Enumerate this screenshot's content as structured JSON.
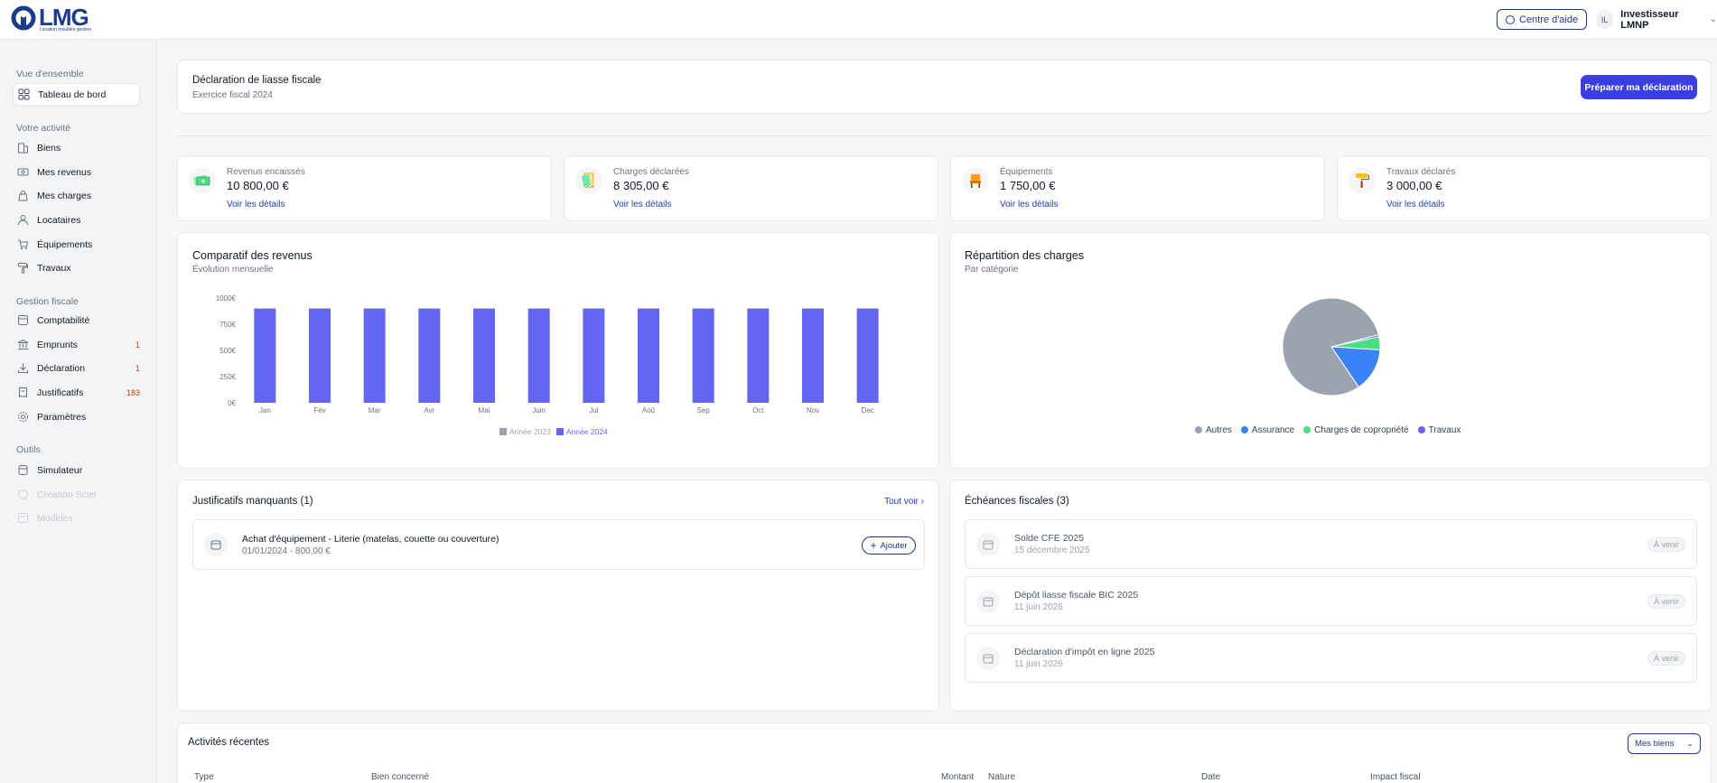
{
  "app": {
    "logo_text": "LMG",
    "logo_subtitle": "Location meublée gestion",
    "help_button": "Centre d'aide",
    "user_initials": "IL",
    "user_name": "Investisseur LMNP"
  },
  "sidebar": {
    "sections": [
      "Vue d'ensemble",
      "Votre activité",
      "Gestion fiscale",
      "Outils"
    ],
    "items": [
      {
        "label": "Tableau de bord",
        "icon": "dashboard-icon",
        "active": true
      },
      {
        "label": "Biens",
        "icon": "building-icon"
      },
      {
        "label": "Mes revenus",
        "icon": "money-icon"
      },
      {
        "label": "Mes charges",
        "icon": "bag-icon"
      },
      {
        "label": "Locataires",
        "icon": "user-icon"
      },
      {
        "label": "Équipements",
        "icon": "cart-icon"
      },
      {
        "label": "Travaux",
        "icon": "paint-roller-icon"
      },
      {
        "label": "Comptabilité",
        "icon": "ledger-icon"
      },
      {
        "label": "Emprunts",
        "icon": "bank-icon",
        "badge": "1"
      },
      {
        "label": "Déclaration",
        "icon": "download-icon",
        "badge": "1"
      },
      {
        "label": "Justificatifs",
        "icon": "receipt-icon",
        "badge": "183"
      },
      {
        "label": "Paramètres",
        "icon": "gear-icon"
      },
      {
        "label": "Simulateur",
        "icon": "calculator-icon"
      },
      {
        "label": "Création Sciel",
        "icon": "shield-icon",
        "disabled": true
      },
      {
        "label": "Modèles",
        "icon": "template-icon",
        "disabled": true
      }
    ]
  },
  "declaration": {
    "title": "Déclaration de liasse fiscale",
    "subtitle": "Exercice fiscal 2024",
    "button": "Préparer ma déclaration"
  },
  "stats": [
    {
      "label": "Revenus encaissés",
      "value": "10 800,00 €",
      "link": "Voir les détails",
      "icon": "cash-icon"
    },
    {
      "label": "Charges déclarées",
      "value": "8 305,00 €",
      "link": "Voir les détails",
      "icon": "invoice-icon"
    },
    {
      "label": "Équipements",
      "value": "1 750,00 €",
      "link": "Voir les détails",
      "icon": "chair-icon"
    },
    {
      "label": "Travaux déclarés",
      "value": "3 000,00 €",
      "link": "Voir les détails",
      "icon": "paint-roller-icon"
    }
  ],
  "revenue_chart": {
    "title": "Comparatif des revenus",
    "subtitle": "Évolution mensuelle",
    "legend": [
      "Année 2023",
      "Année 2024"
    ]
  },
  "charges_chart": {
    "title": "Répartition des charges",
    "subtitle": "Par catégorie",
    "legend": [
      "Autres",
      "Assurance",
      "Charges de copropriété",
      "Travaux"
    ]
  },
  "chart_data": [
    {
      "type": "bar",
      "title": "Comparatif des revenus",
      "subtitle": "Évolution mensuelle",
      "categories": [
        "Jan",
        "Fév",
        "Mar",
        "Avr",
        "Mai",
        "Juin",
        "Jul",
        "Aoû",
        "Sep",
        "Oct",
        "Nov",
        "Dec"
      ],
      "series": [
        {
          "name": "Année 2023",
          "values": [
            0,
            0,
            0,
            0,
            0,
            0,
            0,
            0,
            0,
            0,
            0,
            0
          ],
          "color": "#9ca3af"
        },
        {
          "name": "Année 2024",
          "values": [
            900,
            900,
            900,
            900,
            900,
            900,
            900,
            900,
            900,
            900,
            900,
            900
          ],
          "color": "#6366f1"
        }
      ],
      "y_ticks": [
        "1000€",
        "750€",
        "500€",
        "250€",
        "0€"
      ],
      "ylim": [
        0,
        1000
      ],
      "legend_position": "bottom"
    },
    {
      "type": "pie",
      "title": "Répartition des charges",
      "subtitle": "Par catégorie",
      "labels": [
        "Autres",
        "Assurance",
        "Charges de copropriété",
        "Travaux"
      ],
      "values": [
        80.5,
        14.5,
        4.3,
        0.7
      ],
      "colors": [
        "#9ca3af",
        "#3b82f6",
        "#4ade80",
        "#6366f1"
      ],
      "legend_position": "bottom"
    }
  ],
  "justificatifs": {
    "title": "Justificatifs manquants (1)",
    "see_all": "Tout voir ›",
    "items": [
      {
        "title": "Achat d'équipement - Literie (matelas, couette ou couverture)",
        "meta": "01/01/2024 - 800,00 €",
        "button": "Ajouter"
      }
    ]
  },
  "echeances": {
    "title": "Échéances fiscales (3)",
    "items": [
      {
        "title": "Solde CFE 2025",
        "date": "15 décembre 2025",
        "status": "À venir"
      },
      {
        "title": "Dépôt liasse fiscale BIC 2025",
        "date": "11 juin 2026",
        "status": "À venir"
      },
      {
        "title": "Déclaration d'impôt en ligne 2025",
        "date": "11 juin 2026",
        "status": "À venir"
      }
    ]
  },
  "activities": {
    "title": "Activités récentes",
    "filter": "Mes biens",
    "columns": [
      "Type",
      "Bien concerné",
      "Montant",
      "Nature",
      "Date",
      "Impact fiscal"
    ]
  }
}
